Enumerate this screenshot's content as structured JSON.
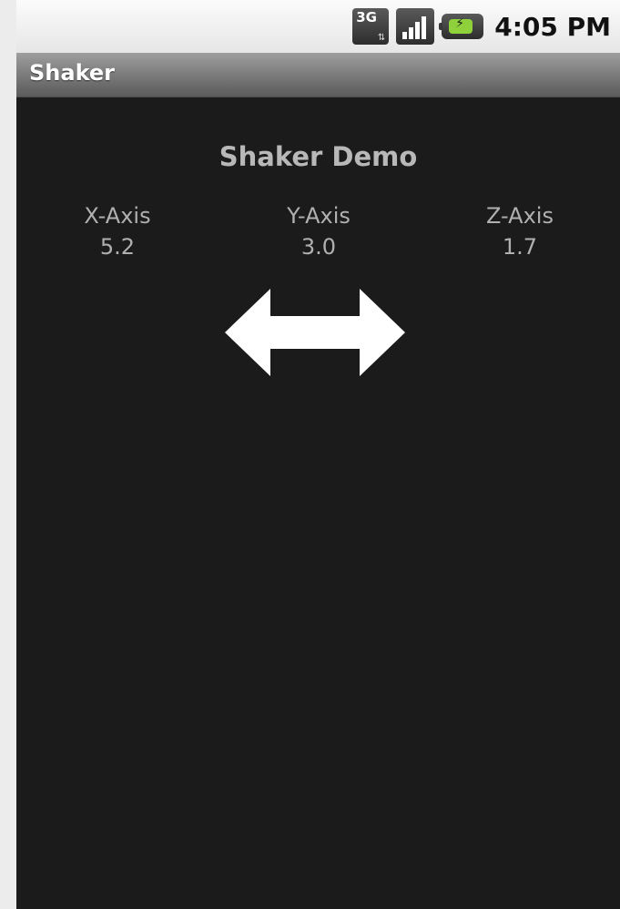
{
  "status_bar": {
    "network_label": "3G",
    "time": "4:05 PM",
    "icons": [
      "network-3g-icon",
      "signal-strength-icon",
      "battery-charging-icon"
    ]
  },
  "app": {
    "title": "Shaker"
  },
  "main": {
    "heading": "Shaker Demo",
    "axes": [
      {
        "label": "X-Axis",
        "value": "5.2"
      },
      {
        "label": "Y-Axis",
        "value": "3.0"
      },
      {
        "label": "Z-Axis",
        "value": "1.7"
      }
    ],
    "indicator_icon": "horizontal-double-arrow-icon"
  },
  "colors": {
    "background": "#1b1b1b",
    "text": "#b0b0b0",
    "battery": "#8ed13b"
  }
}
